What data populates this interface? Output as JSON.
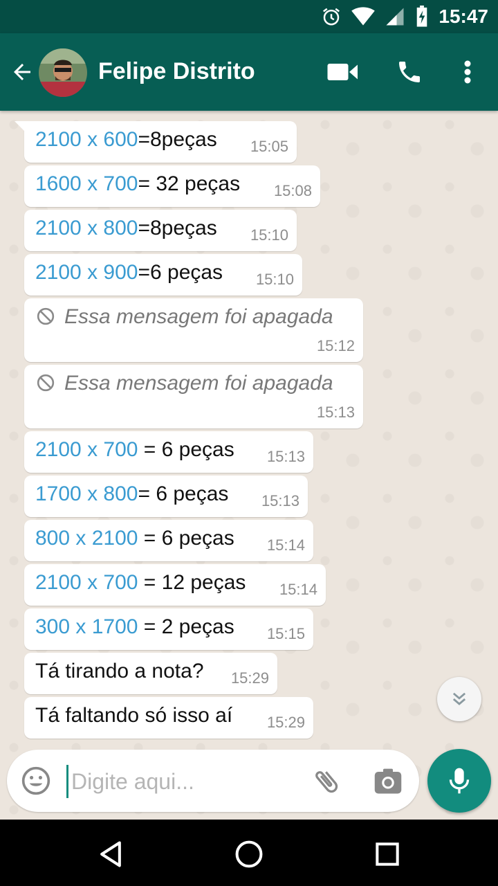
{
  "status_bar": {
    "time": "15:47",
    "icons": [
      "alarm-icon",
      "wifi-icon",
      "signal-icon",
      "battery-charging-icon"
    ]
  },
  "header": {
    "contact_name": "Felipe Distrito",
    "actions": [
      "video-call-icon",
      "phone-call-icon",
      "more-options-icon"
    ]
  },
  "messages": [
    {
      "parts": [
        {
          "text": "2100 x 600",
          "dim": true
        },
        {
          "text": "=8peças"
        }
      ],
      "time": "15:05"
    },
    {
      "parts": [
        {
          "text": "1600 x 700",
          "dim": true
        },
        {
          "text": "= 32 peças"
        }
      ],
      "time": "15:08"
    },
    {
      "parts": [
        {
          "text": "2100 x 800",
          "dim": true
        },
        {
          "text": "=8peças"
        }
      ],
      "time": "15:10"
    },
    {
      "parts": [
        {
          "text": "2100 x 900",
          "dim": true
        },
        {
          "text": "=6 peças"
        }
      ],
      "time": "15:10"
    },
    {
      "deleted": true,
      "text": "Essa mensagem foi apagada",
      "time": "15:12"
    },
    {
      "deleted": true,
      "text": "Essa mensagem foi apagada",
      "time": "15:13"
    },
    {
      "parts": [
        {
          "text": "2100 x 700",
          "dim": true
        },
        {
          "text": " = 6 peças"
        }
      ],
      "time": "15:13"
    },
    {
      "parts": [
        {
          "text": "1700 x 800",
          "dim": true
        },
        {
          "text": "= 6 peças"
        }
      ],
      "time": "15:13"
    },
    {
      "parts": [
        {
          "text": "800 x 2100",
          "dim": true
        },
        {
          "text": " = 6 peças"
        }
      ],
      "time": "15:14"
    },
    {
      "parts": [
        {
          "text": "2100 x 700",
          "dim": true
        },
        {
          "text": " = 12 peças"
        }
      ],
      "time": "15:14"
    },
    {
      "parts": [
        {
          "text": "300 x 1700",
          "dim": true
        },
        {
          "text": " = 2 peças"
        }
      ],
      "time": "15:15"
    },
    {
      "parts": [
        {
          "text": "Tá tirando a nota?"
        }
      ],
      "time": "15:29"
    },
    {
      "parts": [
        {
          "text": "Tá faltando só isso aí"
        }
      ],
      "time": "15:29"
    }
  ],
  "composer": {
    "placeholder": "Digite aqui...",
    "value": ""
  },
  "colors": {
    "header": "#075e54",
    "status_bar": "#054d44",
    "accent": "#128c7e",
    "dimension_text": "#3a9bd1",
    "chat_bg": "#ece5dd"
  }
}
